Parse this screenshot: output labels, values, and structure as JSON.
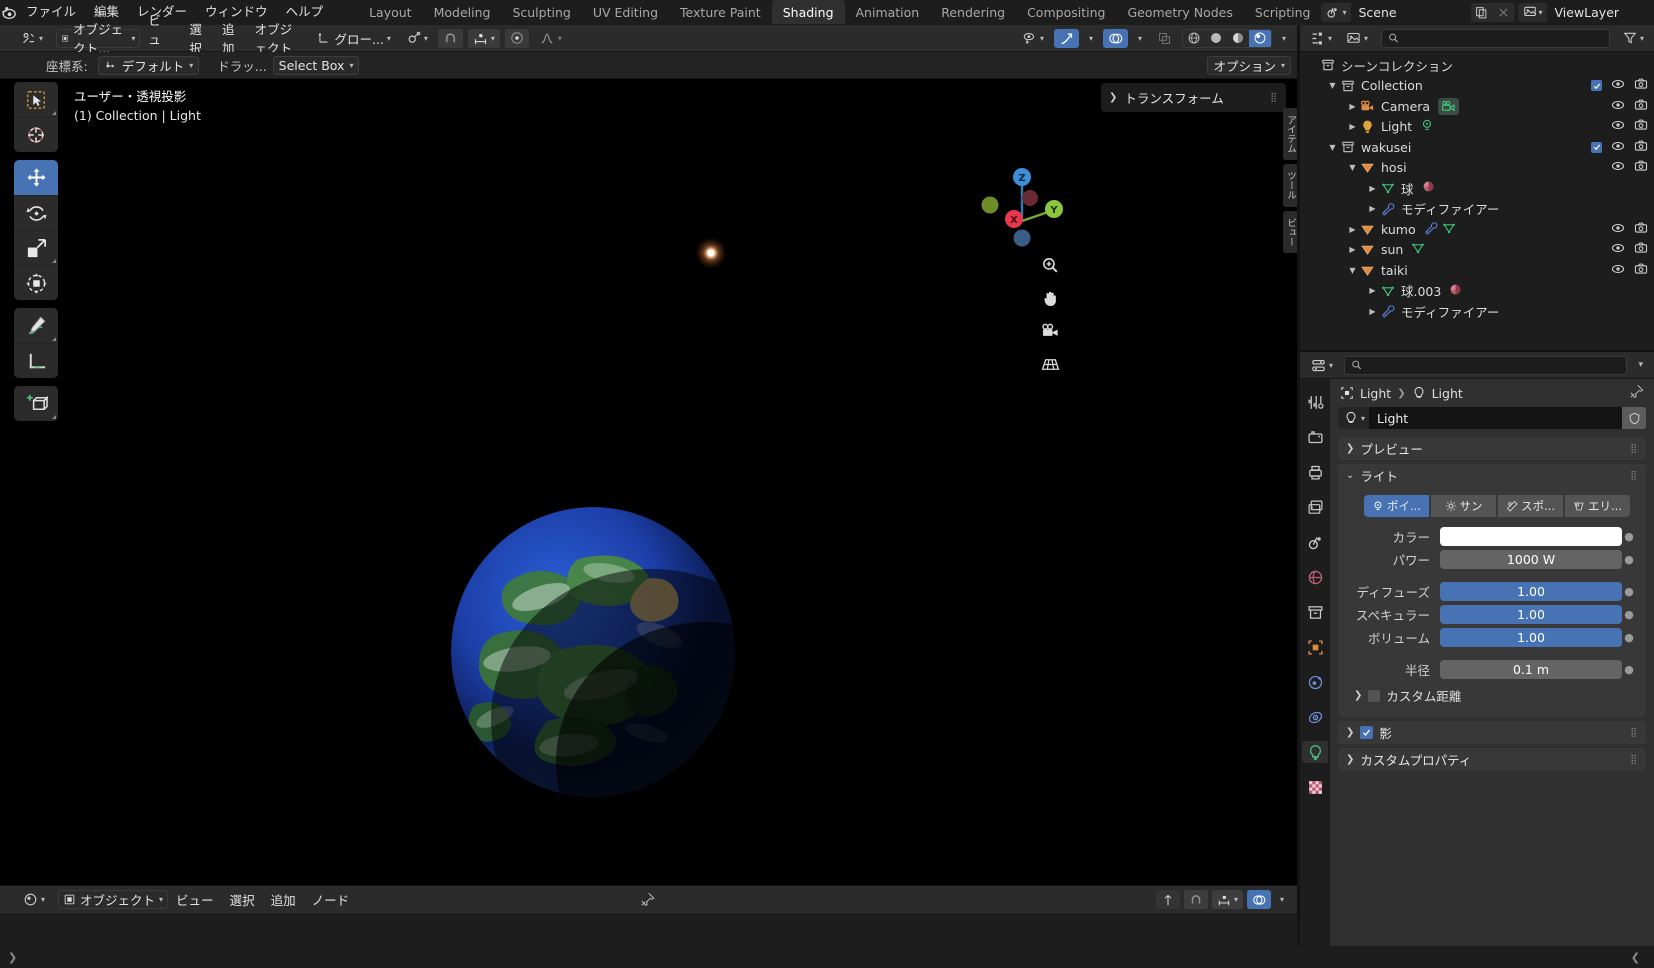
{
  "topbar": {
    "logo_icon": "blender-logo-icon",
    "menus": [
      "ファイル",
      "編集",
      "レンダー",
      "ウィンドウ",
      "ヘルプ"
    ],
    "workspaces": [
      "Layout",
      "Modeling",
      "Sculpting",
      "UV Editing",
      "Texture Paint",
      "Shading",
      "Animation",
      "Rendering",
      "Compositing",
      "Geometry Nodes",
      "Scripting"
    ],
    "active_workspace": "Shading",
    "scene_name": "Scene",
    "viewlayer_name": "ViewLayer"
  },
  "view3d_header": {
    "mode": "オブジェクト...",
    "menus": [
      "ビュー",
      "選択",
      "追加",
      "オブジェクト"
    ],
    "transform_orientation": "グロー...",
    "snap_label": "",
    "proportional": ""
  },
  "toolsettings": {
    "orientation_label": "座標系:",
    "orientation_value": "デフォルト",
    "drag_label": "ドラッ...",
    "drag_value": "Select Box",
    "options_label": "オプション"
  },
  "viewport": {
    "view_name": "ユーザー・透視投影",
    "collection_line": "(1) Collection | Light",
    "gizmo_axes": [
      {
        "label": "Z",
        "color": "#3a8fd8"
      },
      {
        "label": "Y",
        "color": "#8cc63f"
      },
      {
        "label": "X",
        "color": "#e8374e"
      }
    ],
    "nav_icons": [
      "zoom-icon",
      "hand-icon",
      "camera-icon",
      "perspective-icon"
    ],
    "sidepanel": {
      "title": "トランスフォーム"
    },
    "region_tabs": [
      "アイテム",
      "ツール",
      "ビュー"
    ],
    "tools": [
      {
        "name": "tweak-tool",
        "icon": "cursor-box-icon",
        "active": false
      },
      {
        "name": "cursor-tool",
        "icon": "crosshair-icon",
        "active": false
      },
      {
        "name": "move-tool",
        "icon": "move-arrows-icon",
        "active": true
      },
      {
        "name": "rotate-tool",
        "icon": "rotate-icon",
        "active": false
      },
      {
        "name": "scale-tool",
        "icon": "scale-icon",
        "active": false
      },
      {
        "name": "transform-tool",
        "icon": "transform-icon",
        "active": false
      },
      {
        "name": "annotate-tool",
        "icon": "pencil-icon",
        "active": false
      },
      {
        "name": "measure-tool",
        "icon": "ruler-icon",
        "active": false
      },
      {
        "name": "add-cube-tool",
        "icon": "add-cube-icon",
        "active": false
      }
    ]
  },
  "shader_editor": {
    "mode": "オブジェクト",
    "menus": [
      "ビュー",
      "選択",
      "追加",
      "ノード"
    ],
    "pin_icon": "pin-icon"
  },
  "outliner": {
    "display_mode_icon": "outliner-icon",
    "filter_icon": "funnel-icon",
    "search_placeholder": "",
    "rows": [
      {
        "indent": 0,
        "tri": "",
        "icon": "scene-collection-icon",
        "icon_color": "#c8c8c8",
        "label": "シーンコレクション",
        "check": false,
        "eye": false,
        "cam": false,
        "badges": []
      },
      {
        "indent": 1,
        "tri": "down",
        "icon": "collection-icon",
        "icon_color": "#c8c8c8",
        "label": "Collection",
        "check": true,
        "eye": true,
        "cam": true,
        "badges": []
      },
      {
        "indent": 2,
        "tri": "right",
        "icon": "camera-data-icon",
        "icon_color": "#e08a42",
        "label": "Camera",
        "check": false,
        "eye": true,
        "cam": true,
        "badges": [
          "camera-green-icon"
        ]
      },
      {
        "indent": 2,
        "tri": "right",
        "icon": "light-data-icon",
        "icon_color": "#e0a23c",
        "label": "Light",
        "check": false,
        "eye": true,
        "cam": true,
        "badges": [
          "light-green-icon"
        ]
      },
      {
        "indent": 1,
        "tri": "down",
        "icon": "collection-icon",
        "icon_color": "#c8c8c8",
        "label": "wakusei",
        "check": true,
        "eye": true,
        "cam": true,
        "badges": []
      },
      {
        "indent": 2,
        "tri": "down",
        "icon": "mesh-object-icon",
        "icon_color": "#e08a42",
        "label": "hosi",
        "check": false,
        "eye": true,
        "cam": true,
        "badges": []
      },
      {
        "indent": 3,
        "tri": "right",
        "icon": "mesh-data-icon",
        "icon_color": "#3fc17a",
        "label": "球",
        "check": false,
        "eye": false,
        "cam": false,
        "badges": [
          "material-icon"
        ]
      },
      {
        "indent": 3,
        "tri": "right",
        "icon": "modifier-icon",
        "icon_color": "#5b7fd4",
        "label": "モディファイアー",
        "check": false,
        "eye": false,
        "cam": false,
        "badges": []
      },
      {
        "indent": 2,
        "tri": "right",
        "icon": "mesh-object-icon",
        "icon_color": "#e08a42",
        "label": "kumo",
        "check": false,
        "eye": true,
        "cam": true,
        "badges": [
          "modifier-icon",
          "mesh-data-icon"
        ]
      },
      {
        "indent": 2,
        "tri": "right",
        "icon": "mesh-object-icon",
        "icon_color": "#e08a42",
        "label": "sun",
        "check": false,
        "eye": true,
        "cam": true,
        "badges": [
          "mesh-data-icon"
        ]
      },
      {
        "indent": 2,
        "tri": "down",
        "icon": "mesh-object-icon",
        "icon_color": "#e08a42",
        "label": "taiki",
        "check": false,
        "eye": true,
        "cam": true,
        "badges": []
      },
      {
        "indent": 3,
        "tri": "right",
        "icon": "mesh-data-icon",
        "icon_color": "#3fc17a",
        "label": "球.003",
        "check": false,
        "eye": false,
        "cam": false,
        "badges": [
          "material-icon"
        ]
      },
      {
        "indent": 3,
        "tri": "right",
        "icon": "modifier-icon",
        "icon_color": "#5b7fd4",
        "label": "モディファイアー",
        "check": false,
        "eye": false,
        "cam": false,
        "badges": []
      }
    ]
  },
  "properties": {
    "editor_icon": "properties-icon",
    "search_placeholder": "",
    "breadcrumb": [
      "Light",
      "Light"
    ],
    "id_name": "Light",
    "tabs": [
      {
        "name": "tool-tab",
        "icon": "tool-icon",
        "active": false,
        "color": "#c9c9c9"
      },
      {
        "name": "render-tab",
        "icon": "render-camera-icon",
        "active": false,
        "color": "#c9c9c9"
      },
      {
        "name": "output-tab",
        "icon": "printer-icon",
        "active": false,
        "color": "#c9c9c9"
      },
      {
        "name": "viewlayer-tab",
        "icon": "images-icon",
        "active": false,
        "color": "#c9c9c9"
      },
      {
        "name": "scene-tab",
        "icon": "scene-cone-icon",
        "active": false,
        "color": "#c9c9c9"
      },
      {
        "name": "world-tab",
        "icon": "world-globe-icon",
        "active": false,
        "color": "#c0607a"
      },
      {
        "name": "collection-tab",
        "icon": "collection-box-icon",
        "active": false,
        "color": "#c9c9c9"
      },
      {
        "name": "object-tab",
        "icon": "object-square-icon",
        "active": false,
        "color": "#e08a42"
      },
      {
        "name": "modifiers-tab",
        "icon": "physics-orbit-icon",
        "active": false,
        "color": "#6d8fd8"
      },
      {
        "name": "constraints-tab",
        "icon": "constraint-icon",
        "active": false,
        "color": "#6d8fd8"
      },
      {
        "name": "data-tab",
        "icon": "light-bulb-icon",
        "active": true,
        "color": "#4fbf7a"
      },
      {
        "name": "material-tab",
        "icon": "checker-material-icon",
        "active": false,
        "color": "#c0607a"
      }
    ],
    "panels": [
      {
        "name": "preview",
        "title": "プレビュー",
        "open": false
      },
      {
        "name": "light",
        "title": "ライト",
        "open": true
      },
      {
        "name": "shadow",
        "title": "影",
        "open": false,
        "checkbox": true
      },
      {
        "name": "custom-properties",
        "title": "カスタムプロパティ",
        "open": false
      }
    ],
    "light": {
      "types": [
        {
          "label": "ポイ...",
          "icon": "point-light-icon",
          "active": true
        },
        {
          "label": "サン",
          "icon": "sun-light-icon",
          "active": false
        },
        {
          "label": "スポ...",
          "icon": "spot-light-icon",
          "active": false
        },
        {
          "label": "エリ...",
          "icon": "area-light-icon",
          "active": false
        }
      ],
      "fields": [
        {
          "label": "カラー",
          "value": "",
          "style": "white"
        },
        {
          "label": "パワー",
          "value": "1000 W",
          "style": "grey"
        },
        {
          "label": "ディフューズ",
          "value": "1.00",
          "style": "blue"
        },
        {
          "label": "スペキュラー",
          "value": "1.00",
          "style": "blue"
        },
        {
          "label": "ボリューム",
          "value": "1.00",
          "style": "blue"
        },
        {
          "label": "半径",
          "value": "0.1 m",
          "style": "grey"
        }
      ],
      "custom_distance_label": "カスタム距離"
    }
  },
  "colors": {
    "accent_blue": "#4772b3",
    "panel_bg": "#303030",
    "header_bg": "#2b2b2b",
    "editor_bg": "#1d1d1d",
    "viewport_bg": "#000000"
  }
}
